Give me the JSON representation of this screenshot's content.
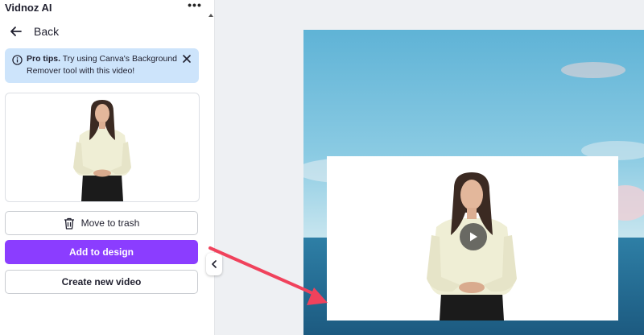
{
  "app": {
    "title": "Vidnoz AI",
    "more_label": "•••"
  },
  "nav": {
    "back_label": "Back"
  },
  "tip": {
    "bold": "Pro tips.",
    "text": " Try using Canva's Background Remover tool with this video!"
  },
  "actions": {
    "trash_label": "Move to trash",
    "add_label": "Add to design",
    "create_label": "Create new video"
  },
  "colors": {
    "accent": "#8b3dff",
    "tip_bg": "#cde4fb",
    "annotation_arrow": "#f0425c"
  }
}
